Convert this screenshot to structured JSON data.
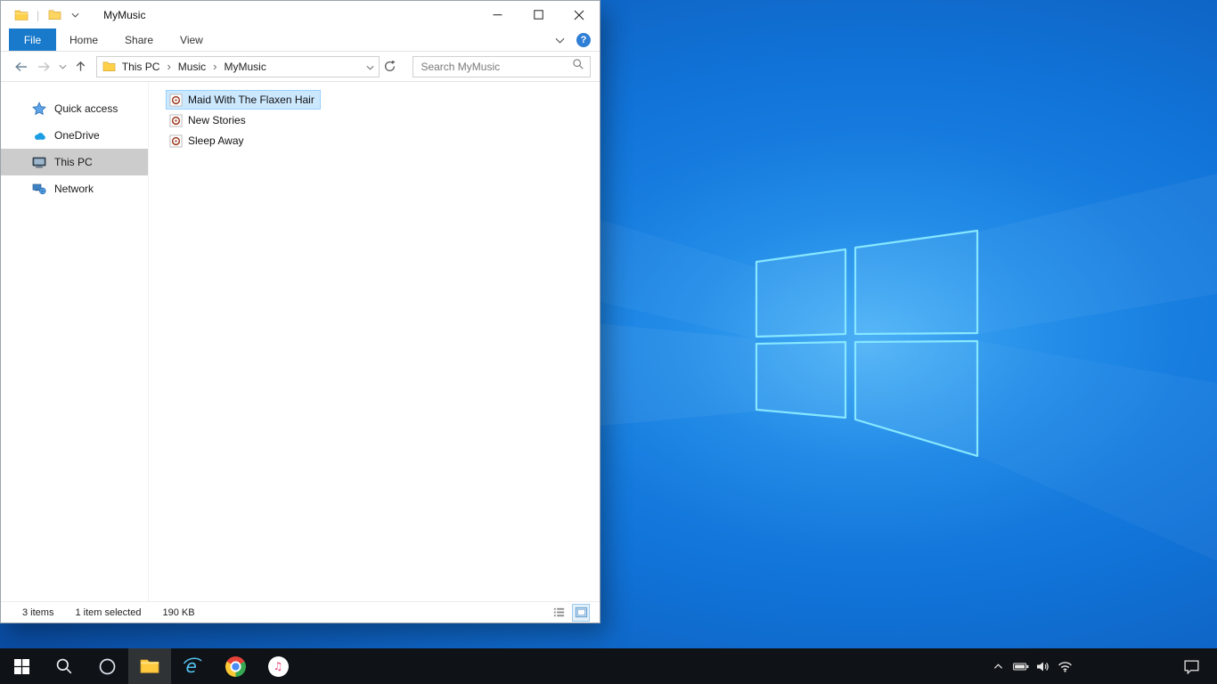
{
  "window": {
    "title": "MyMusic",
    "qat_separator": "|"
  },
  "ribbon": {
    "file_tab": "File",
    "tabs": [
      {
        "label": "Home"
      },
      {
        "label": "Share"
      },
      {
        "label": "View"
      }
    ],
    "help": "?"
  },
  "toolbar": {
    "breadcrumb": {
      "separator": "›",
      "items": [
        {
          "label": "This PC"
        },
        {
          "label": "Music"
        },
        {
          "label": "MyMusic"
        }
      ]
    },
    "search": {
      "placeholder": "Search MyMusic"
    }
  },
  "sidebar": {
    "items": [
      {
        "label": "Quick access",
        "icon": "star-icon",
        "selected": false
      },
      {
        "label": "OneDrive",
        "icon": "cloud-icon",
        "selected": false
      },
      {
        "label": "This PC",
        "icon": "computer-icon",
        "selected": true
      },
      {
        "label": "Network",
        "icon": "network-icon",
        "selected": false
      }
    ]
  },
  "files": [
    {
      "name": "Maid With The Flaxen Hair",
      "icon": "music-file-icon",
      "selected": true
    },
    {
      "name": "New Stories",
      "icon": "music-file-icon",
      "selected": false
    },
    {
      "name": "Sleep Away",
      "icon": "music-file-icon",
      "selected": false
    }
  ],
  "status_bar": {
    "items_count": "3 items",
    "selection": "1 item selected",
    "size": "190 KB"
  },
  "taskbar": {
    "buttons": [
      "start",
      "search",
      "cortana",
      "file-explorer",
      "internet-explorer",
      "chrome",
      "itunes"
    ],
    "active_button": "file-explorer",
    "itunes_note": "♫",
    "tray": [
      "hidden-icons-chevron",
      "battery",
      "volume",
      "network",
      "action-center"
    ]
  },
  "colors": {
    "file_tab_blue": "#1979ca",
    "selection_fill": "#cce8ff",
    "selection_border": "#99d1ff",
    "sidebar_selected": "#cccccc",
    "taskbar_bg": "#0f1216",
    "wallpaper_logo_stroke": "#86e7ff"
  }
}
